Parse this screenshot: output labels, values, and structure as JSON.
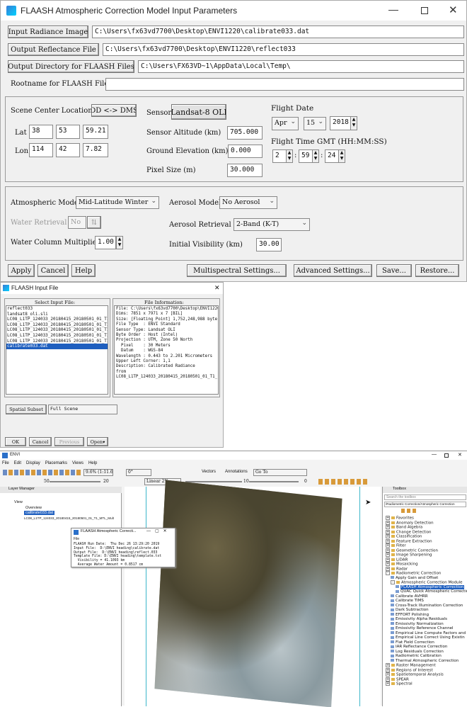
{
  "flaash": {
    "title": "FLAASH Atmospheric Correction Model Input Parameters",
    "input_radiance_label": "Input Radiance Image",
    "input_radiance_value": "C:\\Users\\fx63vd7700\\Desktop\\ENVI1220\\calibrate033.dat",
    "output_reflectance_label": "Output Reflectance File",
    "output_reflectance_value": "C:\\Users\\fx63vd7700\\Desktop\\ENVI1220\\reflect033",
    "output_dir_label": "Output Directory for FLAASH Files",
    "output_dir_value": "C:\\Users\\FX63VD~1\\AppData\\Local\\Temp\\",
    "rootname_label": "Rootname for FLAASH Files",
    "rootname_value": "",
    "scene_center_label": "Scene Center Location",
    "dd_dms_button": "DD <-> DMS",
    "lat_label": "Lat",
    "lat": [
      "38",
      "53",
      "59.21"
    ],
    "lon_label": "Lon",
    "lon": [
      "114",
      "42",
      "7.82"
    ],
    "sensor_type_label": "Sensor Type",
    "sensor_type_value": "Landsat-8 OLI",
    "sensor_altitude_label": "Sensor Altitude (km)",
    "sensor_altitude_value": "705.000",
    "ground_elevation_label": "Ground Elevation (km)",
    "ground_elevation_value": "0.000",
    "pixel_size_label": "Pixel Size (m)",
    "pixel_size_value": "30.000",
    "flight_date_label": "Flight Date",
    "flight_month": "Apr",
    "flight_day": "15",
    "flight_year": "2018",
    "flight_time_label": "Flight Time GMT (HH:MM:SS)",
    "flight_hh": "2",
    "flight_mm": "59",
    "flight_ss": "24",
    "time_sep": ":",
    "atmos_model_label": "Atmospheric Model",
    "atmos_model_value": "Mid-Latitude Winter",
    "water_retrieval_label": "Water Retrieval",
    "water_retrieval_value": "No",
    "water_column_label": "Water Column Multiplier",
    "water_column_value": "1.00",
    "aerosol_model_label": "Aerosol Model",
    "aerosol_model_value": "No Aerosol",
    "aerosol_retrieval_label": "Aerosol Retrieval",
    "aerosol_retrieval_value": "2-Band (K-T)",
    "initial_visibility_label": "Initial Visibility (km)",
    "initial_visibility_value": "30.00",
    "apply": "Apply",
    "cancel": "Cancel",
    "help": "Help",
    "multispectral": "Multispectral Settings...",
    "advanced": "Advanced Settings...",
    "save": "Save...",
    "restore": "Restore..."
  },
  "input_file": {
    "title": "FLAASH Input File",
    "select_label": "Select Input File:",
    "files": [
      "reflect033",
      "landsat8_oli.sli",
      "LC08_L1TP_124033_20180415_20180501_01_T1_",
      "LC08_L1TP_124033_20180415_20180501_01_T1_",
      "LC08_L1TP_124033_20180415_20180501_01_T1_",
      "LC08_L1TP_124033_20180415_20180501_01_T1_",
      "LC08_L1TP_124033_20180415_20180501_01_T1_",
      "calibrate033.dat"
    ],
    "selected_index": 7,
    "info_label": "File Information:",
    "info_lines": [
      "File: C:\\Users\\fx63vd7700\\Desktop\\ENVI1220",
      "Dims: 7851 x 7971 x 7 [BIL]",
      "Size: [Floating Point] 1,752,248,988 byte",
      "File Type  : ENVI Standard",
      "Sensor Type: Landsat OLI",
      "Byte Order : Host (Intel)",
      "Projection : UTM, Zone 50 North",
      "  Pixel    : 30 Meters",
      "  Datum    : WGS-84",
      "Wavelength : 0.443 to 2.201 Micrometers",
      "Upper Left Corner: 1,1",
      "Description: Calibrated Radiance",
      "from",
      "LC08_L1TP_124033_20180415_20180501_01_T1_"
    ],
    "spatial_subset": "Spatial Subset",
    "full_scene": "Full Scene",
    "ok": "OK",
    "cancel": "Cancel",
    "previous": "Previous",
    "open": "Open"
  },
  "envi": {
    "title": "ENVI",
    "menu": [
      "File",
      "Edit",
      "Display",
      "Placemarks",
      "Views",
      "Help"
    ],
    "zoom": "9.6% (1:11.6...",
    "rotation": "0°",
    "vectors": "Vectors",
    "annotations": "Annotations",
    "goto": "Go To",
    "stretch": "Linear 2%",
    "brightness": "50",
    "contrast": "20",
    "sharpen": "10",
    "transparency": "0",
    "layer_manager": "Layer Manager",
    "layers": [
      "View",
      "Overview",
      "calibrate033.dat",
      "LC08_L1TP_124033_20180415_20180501_01_T1_MTL_Mult"
    ],
    "popup_title": "FLAASH Atmospheric Correcti...",
    "popup_menu": "File",
    "popup_lines": [
      "FLAASH Run Date:  Thu Dec 26 13:29:20 2019",
      "Input File:  D:\\ENVI heading\\calibrate.dat",
      "Output File:  D:\\ENVI heading\\reflect.033",
      "Template File: D:\\ENVI heading\\template.txt",
      "  Visibility = 41.1093 km",
      "  Average Water Amount = 0.8517 cm"
    ],
    "toolbox_title": "Toolbox",
    "toolbox_search": "Search the toolbox",
    "toolbox_path": "/Radiometric Correction/Atmospheric Correction",
    "toolbox_items": [
      {
        "t": "Favorites",
        "l": 0,
        "pm": "+"
      },
      {
        "t": "Anomaly Detection",
        "l": 0,
        "pm": "+"
      },
      {
        "t": "Band Algebra",
        "l": 0,
        "pm": "+"
      },
      {
        "t": "Change Detection",
        "l": 0,
        "pm": "+"
      },
      {
        "t": "Classification",
        "l": 0,
        "pm": "+"
      },
      {
        "t": "Feature Extraction",
        "l": 0,
        "pm": "+"
      },
      {
        "t": "Filter",
        "l": 0,
        "pm": "+"
      },
      {
        "t": "Geometric Correction",
        "l": 0,
        "pm": "+"
      },
      {
        "t": "Image Sharpening",
        "l": 0,
        "pm": "+"
      },
      {
        "t": "LiDAR",
        "l": 0,
        "pm": "+"
      },
      {
        "t": "Mosaicking",
        "l": 0,
        "pm": "+"
      },
      {
        "t": "Radar",
        "l": 0,
        "pm": "+"
      },
      {
        "t": "Radiometric Correction",
        "l": 0,
        "pm": "-"
      },
      {
        "t": "Apply Gain and Offset",
        "l": 1,
        "pm": ""
      },
      {
        "t": "Atmospheric Correction Module",
        "l": 1,
        "pm": "-"
      },
      {
        "t": "FLAASH Atmospheric Correction",
        "l": 2,
        "pm": "",
        "sel": true
      },
      {
        "t": "QUAC Quick Atmospheric Correction",
        "l": 2,
        "pm": ""
      },
      {
        "t": "Calibrate AVHRR",
        "l": 1,
        "pm": ""
      },
      {
        "t": "Calibrate TIMS",
        "l": 1,
        "pm": ""
      },
      {
        "t": "Cross-Track Illumination Correction",
        "l": 1,
        "pm": ""
      },
      {
        "t": "Dark Subtraction",
        "l": 1,
        "pm": ""
      },
      {
        "t": "EFFORT Polishing",
        "l": 1,
        "pm": ""
      },
      {
        "t": "Emissivity Alpha Residuals",
        "l": 1,
        "pm": ""
      },
      {
        "t": "Emissivity Normalization",
        "l": 1,
        "pm": ""
      },
      {
        "t": "Emissivity Reference Channel",
        "l": 1,
        "pm": ""
      },
      {
        "t": "Empirical Line Compute Factors and",
        "l": 1,
        "pm": ""
      },
      {
        "t": "Empirical Line Correct Using Existin",
        "l": 1,
        "pm": ""
      },
      {
        "t": "Flat Field Correction",
        "l": 1,
        "pm": ""
      },
      {
        "t": "IAR Reflectance Correction",
        "l": 1,
        "pm": ""
      },
      {
        "t": "Log Residuals Correction",
        "l": 1,
        "pm": ""
      },
      {
        "t": "Radiometric Calibration",
        "l": 1,
        "pm": ""
      },
      {
        "t": "Thermal Atmospheric Correction",
        "l": 1,
        "pm": ""
      },
      {
        "t": "Raster Management",
        "l": 0,
        "pm": "+"
      },
      {
        "t": "Regions of Interest",
        "l": 0,
        "pm": "+"
      },
      {
        "t": "Spatiotemporal Analysis",
        "l": 0,
        "pm": "+"
      },
      {
        "t": "SPEAR",
        "l": 0,
        "pm": "+"
      },
      {
        "t": "Spectral",
        "l": 0,
        "pm": "+"
      }
    ]
  }
}
